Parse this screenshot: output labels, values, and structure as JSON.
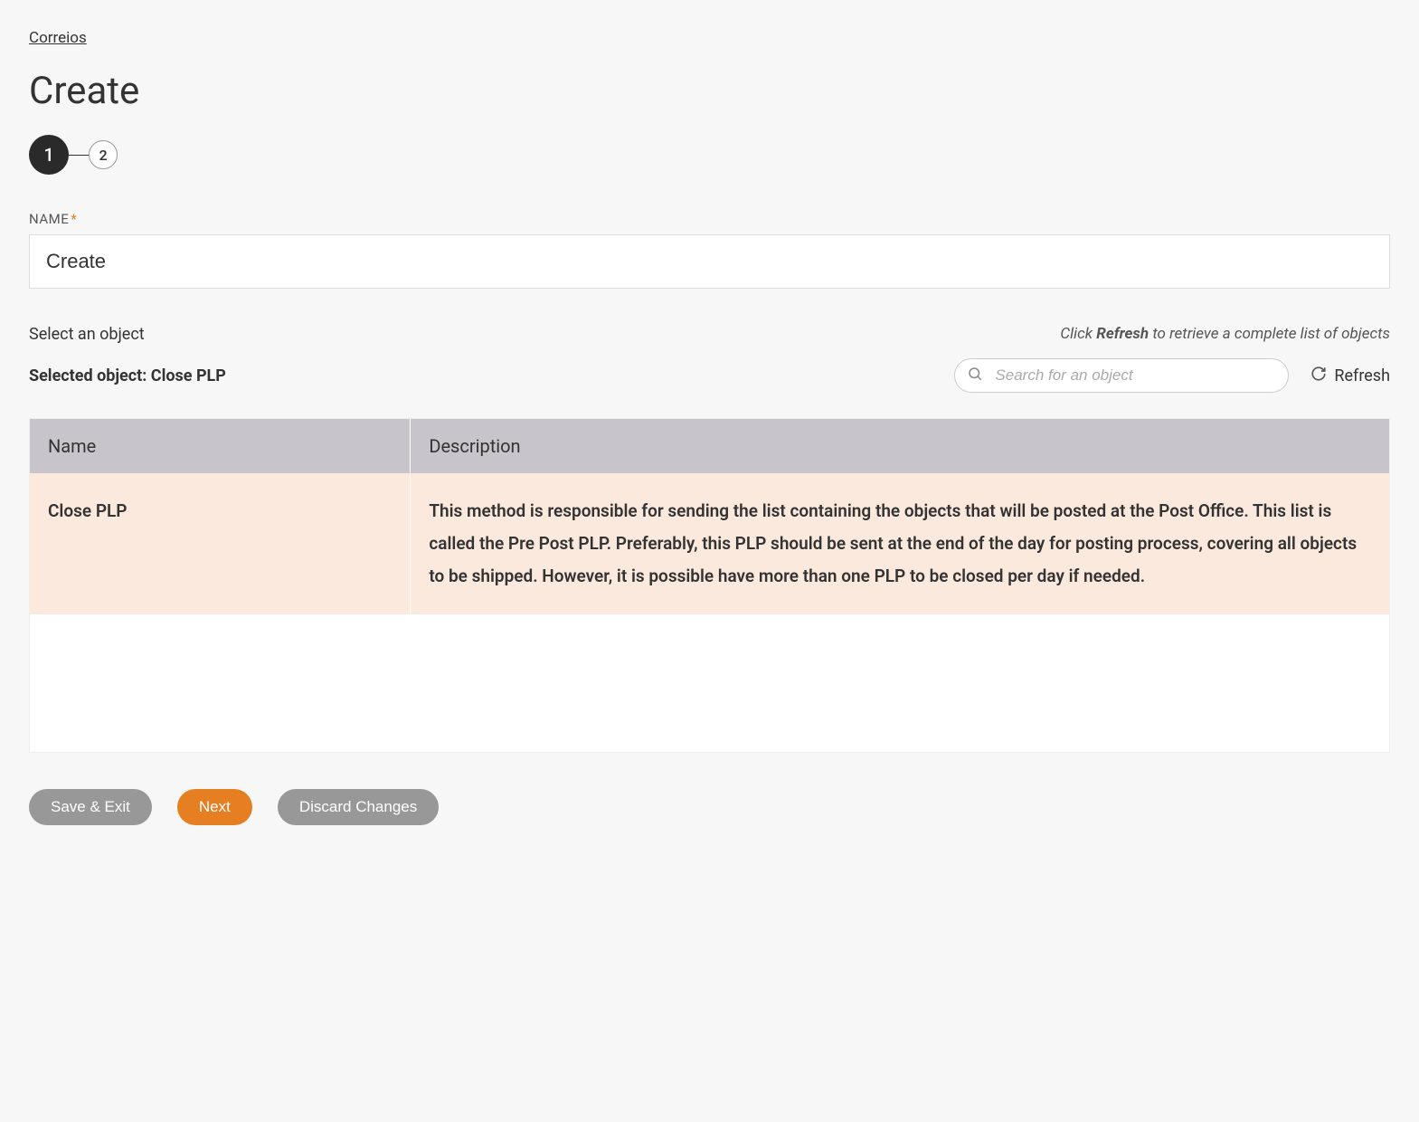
{
  "breadcrumb": {
    "label": "Correios"
  },
  "page": {
    "title": "Create"
  },
  "stepper": {
    "steps": [
      "1",
      "2"
    ],
    "active_index": 0
  },
  "form": {
    "name_label": "NAME",
    "name_required_mark": "*",
    "name_value": "Create"
  },
  "object_section": {
    "select_label": "Select an object",
    "hint_prefix": "Click ",
    "hint_bold": "Refresh",
    "hint_suffix": " to retrieve a complete list of objects",
    "selected_prefix": "Selected object: ",
    "selected_value": "Close PLP",
    "search_placeholder": "Search for an object",
    "refresh_label": "Refresh"
  },
  "table": {
    "headers": {
      "name": "Name",
      "description": "Description"
    },
    "rows": [
      {
        "name": "Close PLP",
        "description": "This method is responsible for sending the list containing the objects that will be posted at the Post Office. This list is called the Pre Post PLP. Preferably, this PLP should be sent at the end of the day for posting process, covering all objects to be shipped. However, it is possible have more than one PLP to be closed per day if needed.",
        "selected": true
      }
    ]
  },
  "buttons": {
    "save_exit": "Save & Exit",
    "next": "Next",
    "discard": "Discard Changes"
  }
}
